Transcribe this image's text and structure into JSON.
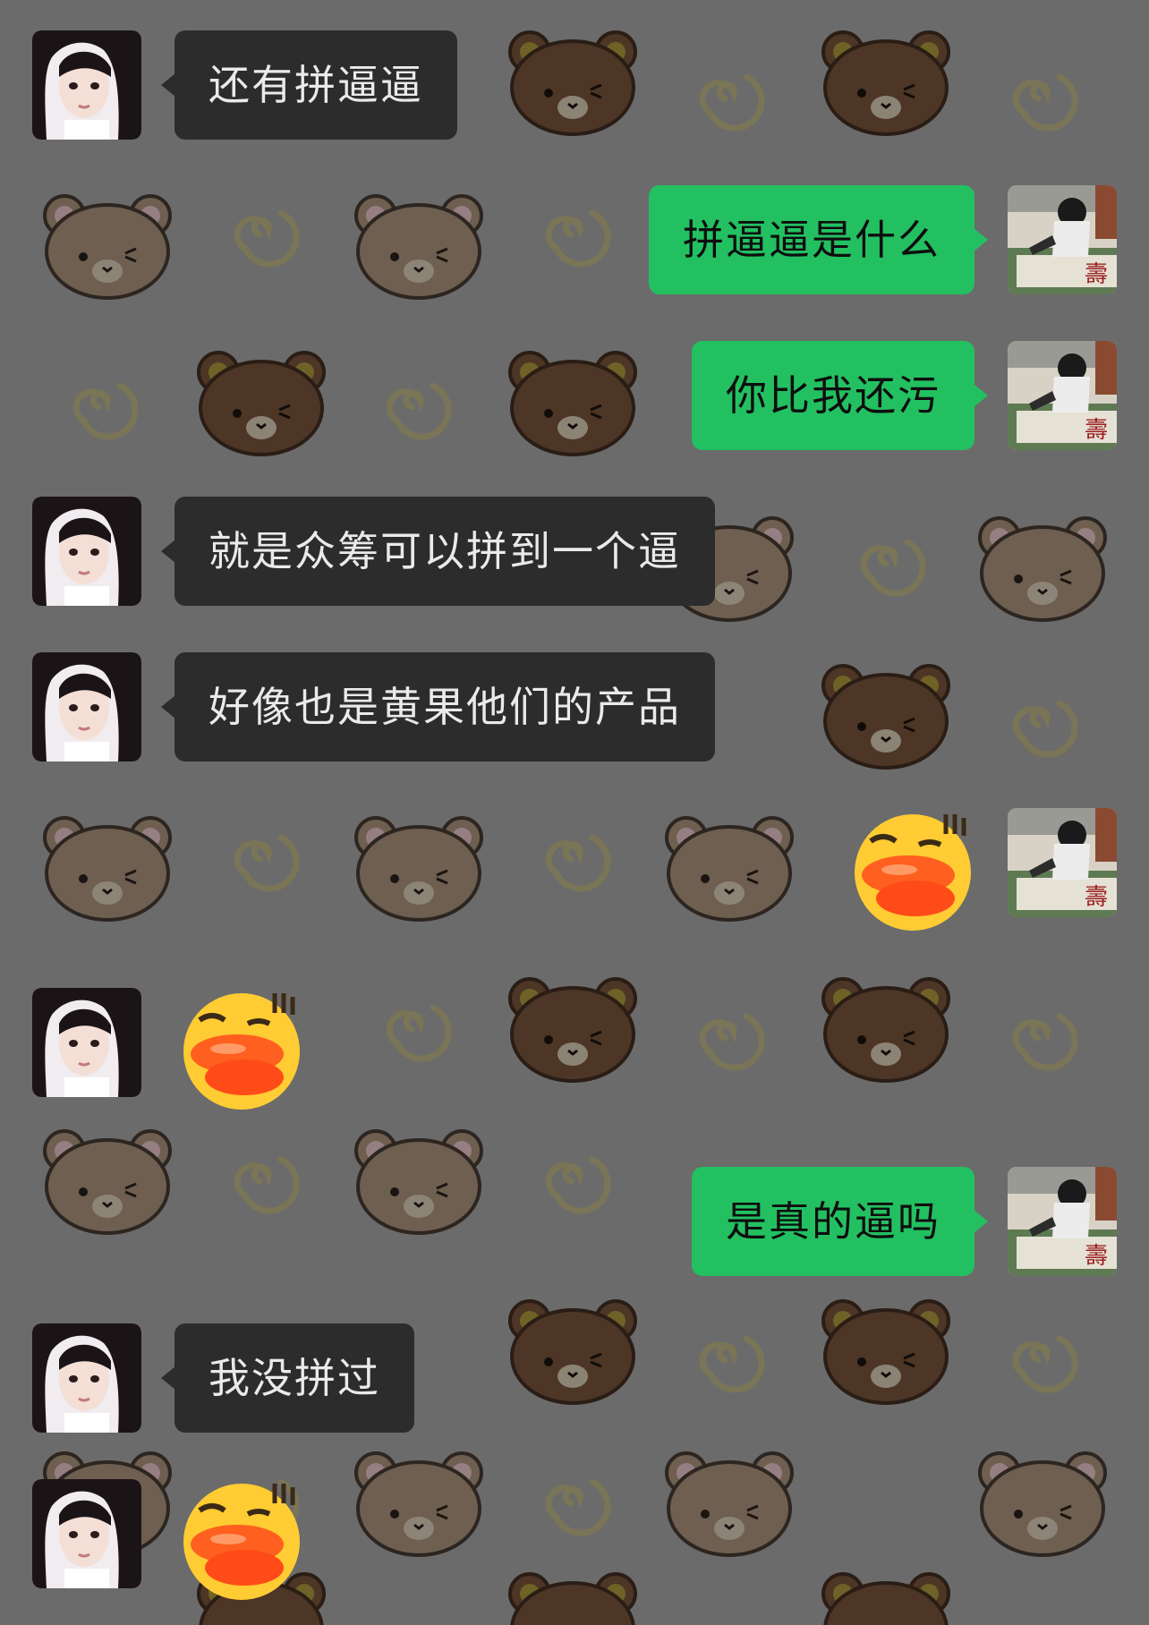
{
  "chat": {
    "background": "#6b6b6b",
    "incoming_bubble_color": "#2c2c2c",
    "outgoing_bubble_color": "#23c061",
    "messages": [
      {
        "side": "incoming",
        "type": "text",
        "text": "还有拼逼逼"
      },
      {
        "side": "outgoing",
        "type": "text",
        "text": "拼逼逼是什么"
      },
      {
        "side": "outgoing",
        "type": "text",
        "text": "你比我还污"
      },
      {
        "side": "incoming",
        "type": "text",
        "text": "就是众筹可以拼到一个逼"
      },
      {
        "side": "incoming",
        "type": "text",
        "text": "好像也是黄果他们的产品"
      },
      {
        "side": "outgoing",
        "type": "sticker",
        "icon": "duck-lips-emoji"
      },
      {
        "side": "incoming",
        "type": "sticker",
        "icon": "duck-lips-emoji"
      },
      {
        "side": "outgoing",
        "type": "text",
        "text": "是真的逼吗"
      },
      {
        "side": "incoming",
        "type": "text",
        "text": "我没拼过"
      },
      {
        "side": "incoming",
        "type": "sticker",
        "icon": "duck-lips-emoji"
      }
    ]
  }
}
